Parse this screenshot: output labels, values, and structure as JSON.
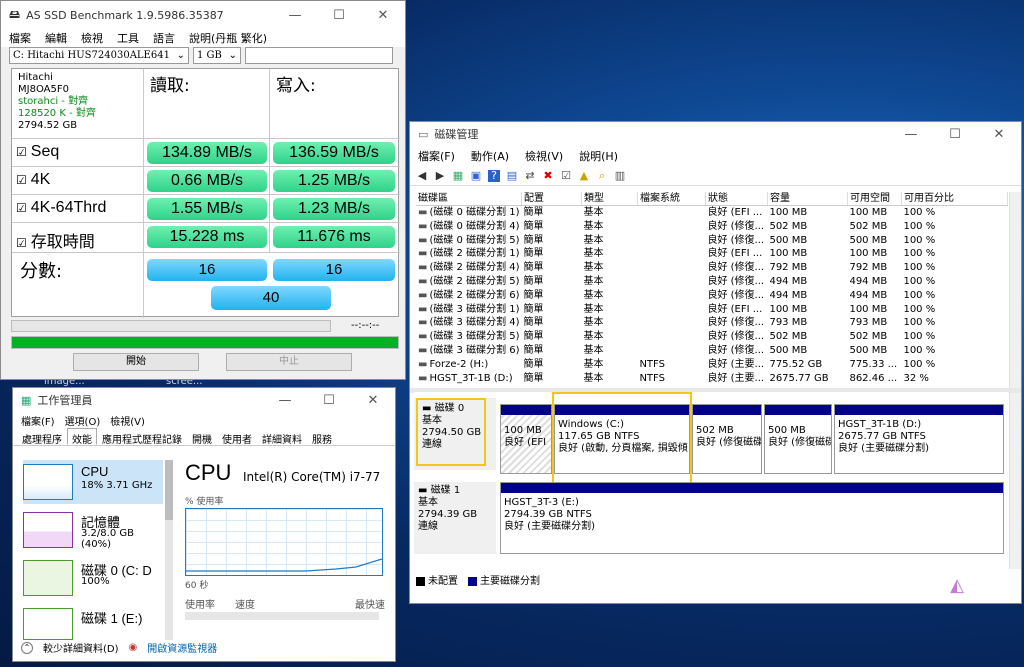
{
  "desktop": {
    "icon_labels": [
      "image...",
      "scree..."
    ]
  },
  "asssd": {
    "title": "AS SSD Benchmark 1.9.5986.35387",
    "menu": [
      "檔案",
      "編輯",
      "檢視",
      "工具",
      "語言",
      "說明(丹瓶 繁化)"
    ],
    "drive_select": "C: Hitachi HUS724030ALE641",
    "size_select": "1 GB",
    "drive_info": [
      "Hitachi",
      "MJ8OA5F0",
      "storahci - 對齊",
      "128520 K - 對齊",
      "2794.52 GB"
    ],
    "header_read": "讀取:",
    "header_write": "寫入:",
    "rows": [
      {
        "label": "Seq",
        "read": "134.89 MB/s",
        "write": "136.59 MB/s"
      },
      {
        "label": "4K",
        "read": "0.66 MB/s",
        "write": "1.25 MB/s"
      },
      {
        "label": "4K-64Thrd",
        "read": "1.55 MB/s",
        "write": "1.23 MB/s"
      },
      {
        "label": "存取時間",
        "read": "15.228 ms",
        "write": "11.676 ms"
      }
    ],
    "score_label": "分數:",
    "score_read": "16",
    "score_write": "16",
    "score_total": "40",
    "elapsed": "--:--:--",
    "progress": 1.0,
    "start_btn": "開始",
    "stop_btn": "中止",
    "checkbox": "☑"
  },
  "dm": {
    "title": "磁碟管理",
    "menu": [
      "檔案(F)",
      "動作(A)",
      "檢視(V)",
      "說明(H)"
    ],
    "columns": [
      "磁碟區",
      "配置",
      "類型",
      "檔案系統",
      "狀態",
      "容量",
      "可用空間",
      "可用百分比"
    ],
    "rows": [
      [
        "(磁碟 0 磁碟分割 1)",
        "簡單",
        "基本",
        "",
        "良好 (EFI ...",
        "100 MB",
        "100 MB",
        "100 %"
      ],
      [
        "(磁碟 0 磁碟分割 4)",
        "簡單",
        "基本",
        "",
        "良好 (修復...",
        "502 MB",
        "502 MB",
        "100 %"
      ],
      [
        "(磁碟 0 磁碟分割 5)",
        "簡單",
        "基本",
        "",
        "良好 (修復...",
        "500 MB",
        "500 MB",
        "100 %"
      ],
      [
        "(磁碟 2 磁碟分割 1)",
        "簡單",
        "基本",
        "",
        "良好 (EFI ...",
        "100 MB",
        "100 MB",
        "100 %"
      ],
      [
        "(磁碟 2 磁碟分割 4)",
        "簡單",
        "基本",
        "",
        "良好 (修復...",
        "792 MB",
        "792 MB",
        "100 %"
      ],
      [
        "(磁碟 2 磁碟分割 5)",
        "簡單",
        "基本",
        "",
        "良好 (修復...",
        "494 MB",
        "494 MB",
        "100 %"
      ],
      [
        "(磁碟 2 磁碟分割 6)",
        "簡單",
        "基本",
        "",
        "良好 (修復...",
        "494 MB",
        "494 MB",
        "100 %"
      ],
      [
        "(磁碟 3 磁碟分割 1)",
        "簡單",
        "基本",
        "",
        "良好 (EFI ...",
        "100 MB",
        "100 MB",
        "100 %"
      ],
      [
        "(磁碟 3 磁碟分割 4)",
        "簡單",
        "基本",
        "",
        "良好 (修復...",
        "793 MB",
        "793 MB",
        "100 %"
      ],
      [
        "(磁碟 3 磁碟分割 5)",
        "簡單",
        "基本",
        "",
        "良好 (修復...",
        "502 MB",
        "502 MB",
        "100 %"
      ],
      [
        "(磁碟 3 磁碟分割 6)",
        "簡單",
        "基本",
        "",
        "良好 (修復...",
        "500 MB",
        "500 MB",
        "100 %"
      ],
      [
        "Forze-2 (H:)",
        "簡單",
        "基本",
        "NTFS",
        "良好 (主要...",
        "775.52 GB",
        "775.33 ...",
        "100 %"
      ],
      [
        "HGST_3T-1B (D:)",
        "簡單",
        "基本",
        "NTFS",
        "良好 (主要...",
        "2675.77 GB",
        "862.46 ...",
        "32 %"
      ]
    ],
    "disk0": {
      "name": "磁碟 0",
      "type": "基本",
      "size": "2794.50 GB",
      "status": "連線"
    },
    "disk0_parts": [
      {
        "l1": "",
        "l2": "100 MB",
        "l3": "良好 (EFI"
      },
      {
        "l1": "Windows (C:)",
        "l2": "117.65 GB NTFS",
        "l3": "良好 (啟動, 分頁檔案, 損毀傾"
      },
      {
        "l1": "",
        "l2": "502 MB",
        "l3": "良好 (修復磁碟"
      },
      {
        "l1": "",
        "l2": "500 MB",
        "l3": "良好 (修復磁碟"
      },
      {
        "l1": "HGST_3T-1B (D:)",
        "l2": "2675.77 GB NTFS",
        "l3": "良好 (主要磁碟分割)"
      }
    ],
    "disk1": {
      "name": "磁碟 1",
      "type": "基本",
      "size": "2794.39 GB",
      "status": "連線"
    },
    "disk1_part": {
      "l1": "HGST_3T-3 (E:)",
      "l2": "2794.39 GB NTFS",
      "l3": "良好 (主要磁碟分割)"
    },
    "legend_unalloc": "未配置",
    "legend_primary": "主要磁碟分割",
    "colors": {
      "partition_bar": "#00008b",
      "highlight": "#f5c518"
    }
  },
  "tm": {
    "title": "工作管理員",
    "menu": [
      "檔案(F)",
      "選項(O)",
      "檢視(V)"
    ],
    "tabs": [
      "處理程序",
      "效能",
      "應用程式歷程記錄",
      "開機",
      "使用者",
      "詳細資料",
      "服務"
    ],
    "side": [
      {
        "name": "CPU",
        "sub": "18% 3.71 GHz"
      },
      {
        "name": "記憶體",
        "sub": "3.2/8.0 GB (40%)"
      },
      {
        "name": "磁碟 0 (C: D",
        "sub": "100%"
      },
      {
        "name": "磁碟 1 (E:)",
        "sub": ""
      }
    ],
    "main_title": "CPU",
    "cpu_model": "Intel(R) Core(TM) i7-77",
    "usage_label": "% 使用率",
    "seconds": "60 秒",
    "usage_rate": "使用率",
    "speed": "速度",
    "max_speed": "最快速",
    "fewer_details": "較少詳細資料(D)",
    "open_monitor": "開啟資源監視器"
  }
}
